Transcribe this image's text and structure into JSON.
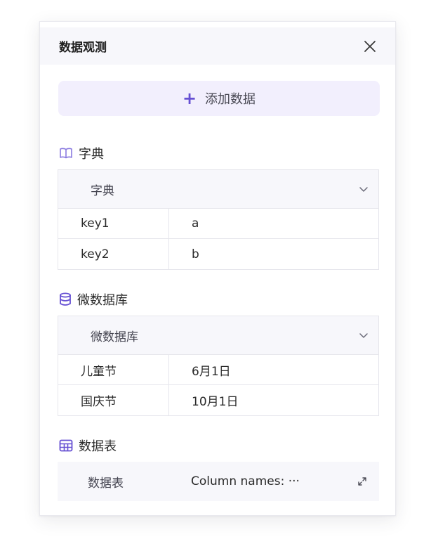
{
  "panel": {
    "title": "数据观测",
    "add_button_label": "添加数据"
  },
  "sections": {
    "dict": {
      "title": "字典",
      "icon": "book-icon",
      "select_label": "字典",
      "rows": [
        {
          "key": "key1",
          "value": "a"
        },
        {
          "key": "key2",
          "value": "b"
        }
      ]
    },
    "tinydb": {
      "title": "微数据库",
      "icon": "database-icon",
      "select_label": "微数据库",
      "rows": [
        {
          "key": "儿童节",
          "value": "6月1日"
        },
        {
          "key": "国庆节",
          "value": "10月1日"
        }
      ]
    },
    "dataframe": {
      "title": "数据表",
      "icon": "table-icon",
      "row_label": "数据表",
      "row_value": "Column names: ···"
    }
  },
  "colors": {
    "accent": "#6650d3",
    "header_bg": "#f7f7fb",
    "add_button_bg": "#f2effd",
    "border": "#e6e6ec"
  }
}
